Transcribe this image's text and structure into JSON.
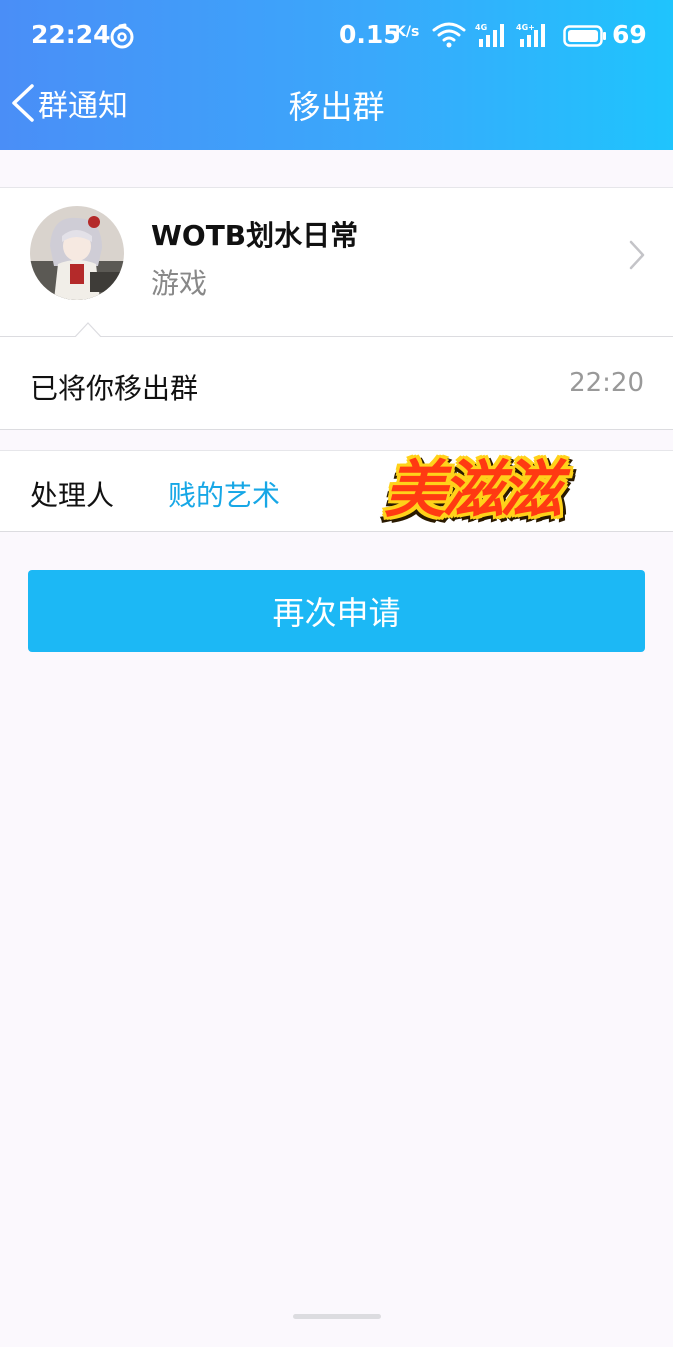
{
  "status_bar": {
    "time": "22:24",
    "speed_value": "0.15",
    "speed_unit": "K/s",
    "network_1": "4G",
    "network_2": "4G+",
    "battery_percent": "69"
  },
  "nav": {
    "back_label": "群通知",
    "title": "移出群"
  },
  "group": {
    "name": "WOTB划水日常",
    "category": "游戏"
  },
  "notice": {
    "text": "已将你移出群",
    "time": "22:20"
  },
  "handler": {
    "label": "处理人",
    "name": "贱的艺术"
  },
  "sticker_text": "美滋滋",
  "actions": {
    "apply_again": "再次申请"
  },
  "colors": {
    "header_gradient_start": "#4a8ef7",
    "header_gradient_end": "#1fc4fd",
    "accent_link": "#17a7e6",
    "button_bg": "#1cb8f5",
    "page_bg": "#fbf8fd"
  }
}
